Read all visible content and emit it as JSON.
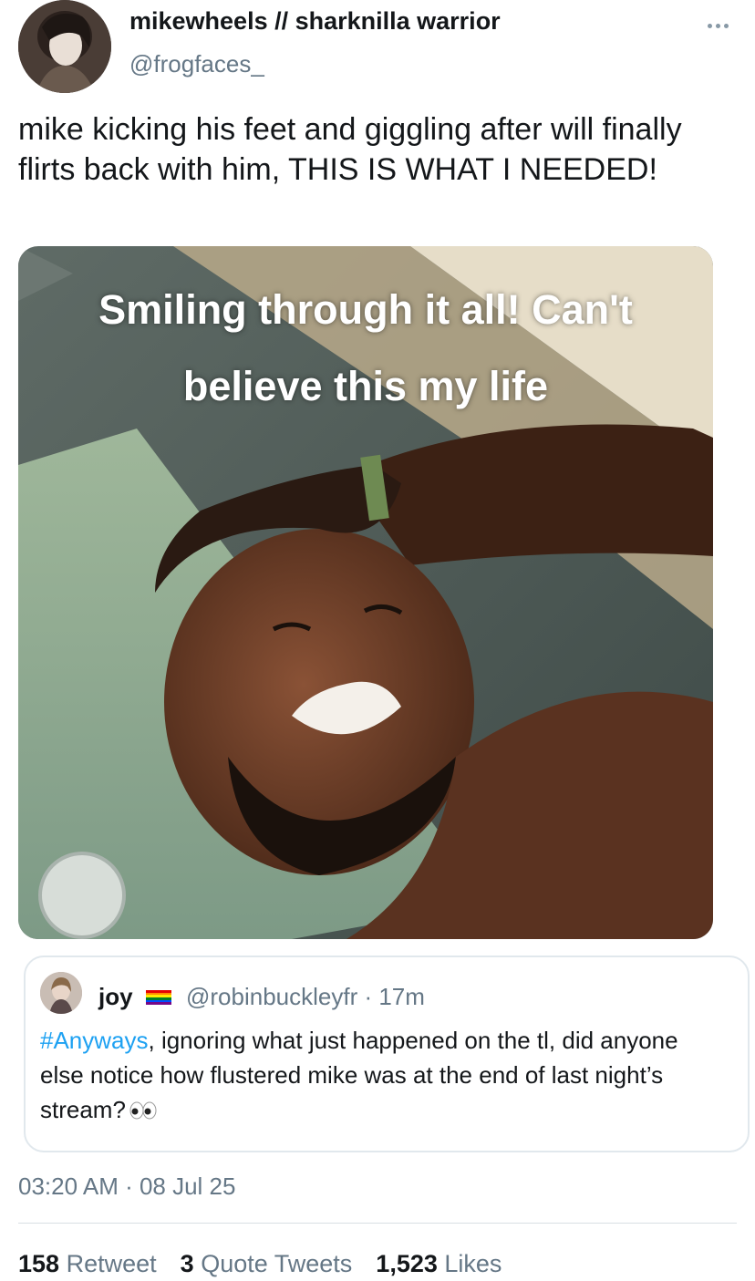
{
  "tweet": {
    "author_name": "mikewheels // sharknilla warrior",
    "author_handle": "@frogfaces_",
    "text": "mike kicking his feet and giggling after will finally flirts back with him, THIS IS WHAT I NEEDED!",
    "media_caption": "Smiling through it all! Can't believe this my life",
    "timestamp": "03:20 AM · 08 Jul 25"
  },
  "quoted": {
    "name": "joy",
    "handle_time": "@robinbuckleyfr · 17m",
    "hashtag": "#Anyways",
    "text": ", ignoring what just happened on the tl, did anyone else notice how flustered mike was at the end of last night’s stream?",
    "emoji_icon": "eyes-icon",
    "flag_icon": "rainbow-flag-icon"
  },
  "stats": {
    "retweets_count": "158",
    "retweets_label": "Retweet",
    "quotes_count": "3",
    "quotes_label": "Quote Tweets",
    "likes_count": "1,523",
    "likes_label": "Likes"
  },
  "colors": {
    "text": "#14171a",
    "secondary": "#657786",
    "link": "#1da1f2",
    "border": "#e1e8ed"
  }
}
